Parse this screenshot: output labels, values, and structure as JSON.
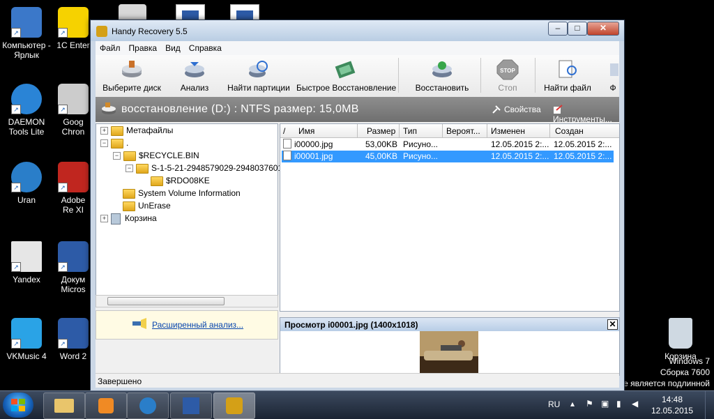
{
  "desktop": {
    "icons": [
      {
        "label": "Компьютер - Ярлык",
        "color": "#3b78c9"
      },
      {
        "label": "1C Enter",
        "color": "#f6d200"
      },
      {
        "label": "DAEMON Tools Lite",
        "color": "#2a84d6"
      },
      {
        "label": "Goog Chron",
        "color": "#cccccc"
      },
      {
        "label": "Uran",
        "color": "#2a7ec9"
      },
      {
        "label": "Adobe Re XI",
        "color": "#c0261f"
      },
      {
        "label": "Yandex",
        "color": "#e6e6e6"
      },
      {
        "label": "Докум Micros",
        "color": "#2d5ba7"
      },
      {
        "label": "VKMusic 4",
        "color": "#2aa3e6"
      },
      {
        "label": "Word 2",
        "color": "#2d5ba7"
      },
      {
        "label": "Корзина",
        "color": "#cfd9e2"
      }
    ],
    "watermark": {
      "line1": "Windows 7",
      "line2": "Сборка 7600",
      "line3": "е является подлинной"
    }
  },
  "window": {
    "title": "Handy Recovery 5.5",
    "menu": [
      "Файл",
      "Правка",
      "Вид",
      "Справка"
    ],
    "toolbar": [
      {
        "label": "Выберите диск",
        "icon": "select-disk-icon",
        "enabled": true
      },
      {
        "label": "Анализ",
        "icon": "analyze-icon",
        "enabled": true
      },
      {
        "label": "Найти партиции",
        "icon": "find-partitions-icon",
        "enabled": true
      },
      {
        "label": "Быстрое Восстановление",
        "icon": "quick-recovery-icon",
        "enabled": true
      },
      {
        "label": "Восстановить",
        "icon": "recover-icon",
        "enabled": true
      },
      {
        "label": "Стоп",
        "icon": "stop-icon",
        "enabled": false
      },
      {
        "label": "Найти файл",
        "icon": "find-file-icon",
        "enabled": true
      },
      {
        "label": "Ф",
        "icon": "filter-icon",
        "enabled": true
      }
    ],
    "stop_text": "STOP",
    "header": {
      "title": "восстановление (D:) : NTFS размер: 15,0MB",
      "properties": "Свойства",
      "tools": "Инструменты..."
    },
    "tree": [
      {
        "label": "Метафайлы",
        "expander": "+",
        "level": 0
      },
      {
        "label": ".",
        "expander": "−",
        "level": 0
      },
      {
        "label": "$RECYCLE.BIN",
        "expander": "−",
        "level": 1
      },
      {
        "label": "S-1-5-21-2948579029-2948037601-",
        "expander": "−",
        "level": 2
      },
      {
        "label": "$RDO08KE",
        "expander": "",
        "level": 3
      },
      {
        "label": "System Volume Information",
        "expander": "",
        "level": 1
      },
      {
        "label": "UnErase",
        "expander": "",
        "level": 1
      },
      {
        "label": "Корзина",
        "expander": "+",
        "level": 0
      }
    ],
    "advanced_link": "Расширенный анализ...",
    "list": {
      "columns": [
        "Имя",
        "Размер",
        "Тип",
        "Вероят...",
        "Изменен",
        "Создан"
      ],
      "rows": [
        {
          "name": "i00000.jpg",
          "size": "53,00KB",
          "type": "Рисуно...",
          "prob": "",
          "modified": "12.05.2015 2:...",
          "created": "12.05.2015 2:...",
          "selected": false
        },
        {
          "name": "i00001.jpg",
          "size": "45,00KB",
          "type": "Рисуно...",
          "prob": "",
          "modified": "12.05.2015 2:...",
          "created": "12.05.2015 2:...",
          "selected": true
        }
      ]
    },
    "preview": {
      "title": "Просмотр i00001.jpg (1400x1018)",
      "close": "✕"
    },
    "status": "Завершено"
  },
  "taskbar": {
    "lang": "RU",
    "time": "14:48",
    "date": "12.05.2015",
    "apps": [
      "explorer-icon",
      "media-player-icon",
      "browser-icon",
      "word-icon",
      "handy-recovery-icon"
    ]
  }
}
